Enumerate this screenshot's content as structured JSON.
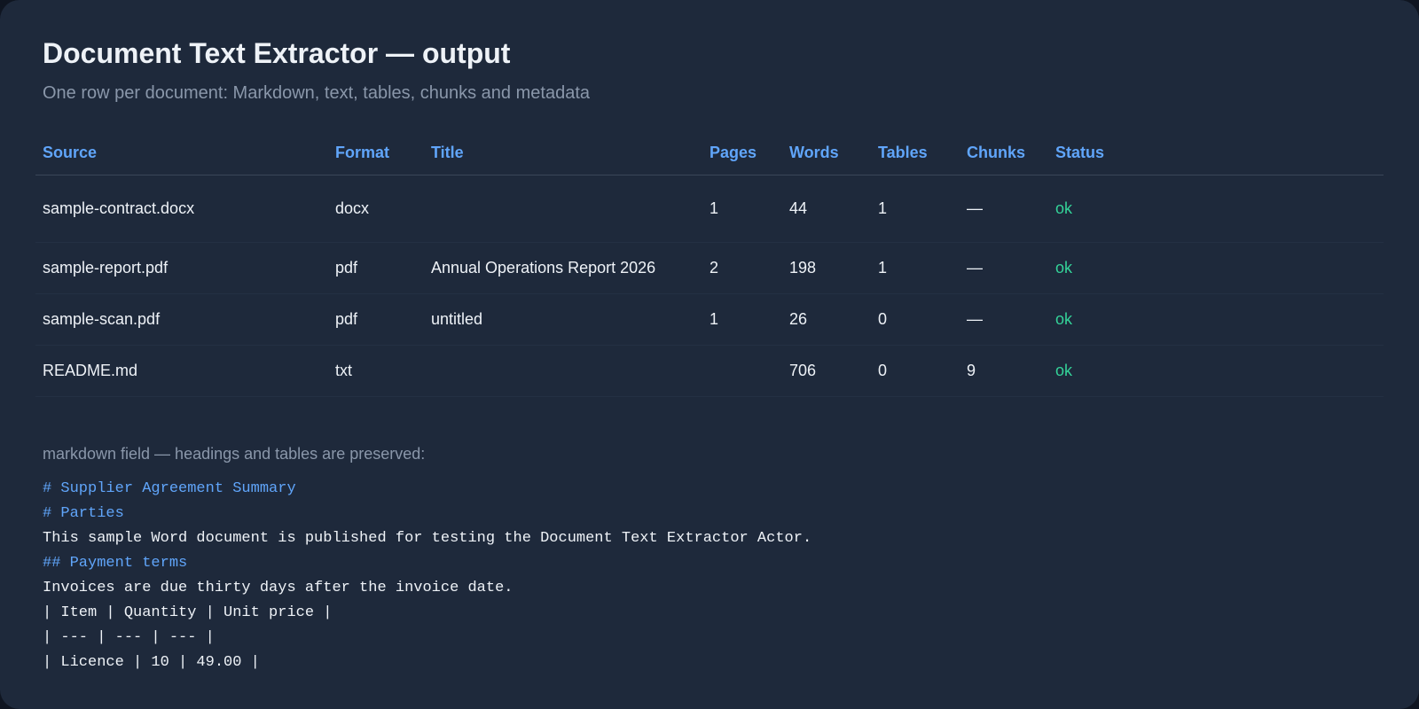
{
  "header": {
    "title": "Document Text Extractor — output",
    "subtitle": "One row per document: Markdown, text, tables, chunks and metadata"
  },
  "table": {
    "columns": [
      "Source",
      "Format",
      "Title",
      "Pages",
      "Words",
      "Tables",
      "Chunks",
      "Status"
    ],
    "rows": [
      {
        "source": "sample-contract.docx",
        "format": "docx",
        "title": "",
        "pages": "1",
        "words": "44",
        "tables": "1",
        "chunks": "—",
        "status": "ok"
      },
      {
        "source": "sample-report.pdf",
        "format": "pdf",
        "title": "Annual Operations Report 2026",
        "pages": "2",
        "words": "198",
        "tables": "1",
        "chunks": "—",
        "status": "ok"
      },
      {
        "source": "sample-scan.pdf",
        "format": "pdf",
        "title": "untitled",
        "pages": "1",
        "words": "26",
        "tables": "0",
        "chunks": "—",
        "status": "ok"
      },
      {
        "source": "README.md",
        "format": "txt",
        "title": "",
        "pages": "",
        "words": "706",
        "tables": "0",
        "chunks": "9",
        "status": "ok"
      }
    ]
  },
  "markdown": {
    "label": "markdown field — headings and tables are preserved:",
    "lines": [
      "# Supplier Agreement Summary",
      "# Parties",
      "This sample Word document is published for testing the Document Text Extractor Actor.",
      "## Payment terms",
      "Invoices are due thirty days after the invoice date.",
      "| Item | Quantity | Unit price |",
      "| --- | --- | --- |",
      "| Licence | 10 | 49.00 |"
    ]
  },
  "colors": {
    "background": "#1e293b",
    "heading_accent": "#60a5fa",
    "status_ok": "#34d399",
    "muted_text": "#8a97aa"
  }
}
